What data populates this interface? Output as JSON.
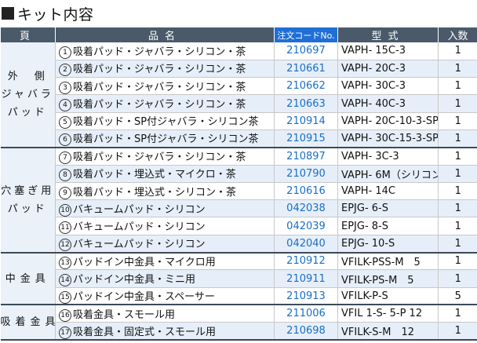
{
  "title": "キット内容",
  "header": {
    "page": "頁",
    "name": "品名",
    "code": "注文コードNo.",
    "model": "型式",
    "qty": "入数"
  },
  "groups": [
    {
      "label_lines": [
        "外　側",
        "ジャバラ",
        "パッド"
      ],
      "rows": [
        {
          "num": "1",
          "name": "吸着パッド・ジャバラ・シリコン・茶",
          "code": "210697",
          "model": "VAPH- 15C-3",
          "qty": "1"
        },
        {
          "num": "2",
          "name": "吸着パッド・ジャバラ・シリコン・茶",
          "code": "210661",
          "model": "VAPH- 20C-3",
          "qty": "1"
        },
        {
          "num": "3",
          "name": "吸着パッド・ジャバラ・シリコン・茶",
          "code": "210662",
          "model": "VAPH- 30C-3",
          "qty": "1"
        },
        {
          "num": "4",
          "name": "吸着パッド・ジャバラ・シリコン・茶",
          "code": "210663",
          "model": "VAPH- 40C-3",
          "qty": "1"
        },
        {
          "num": "5",
          "name": "吸着パッド・SP付ジャバラ・シリコン茶",
          "code": "210914",
          "model": "VAPH- 20C-10-3-SP",
          "qty": "1"
        },
        {
          "num": "6",
          "name": "吸着パッド・SP付ジャバラ・シリコン茶",
          "code": "210915",
          "model": "VAPH- 30C-15-3-SP",
          "qty": "1"
        }
      ]
    },
    {
      "label_lines": [
        "穴塞ぎ用",
        "パッド"
      ],
      "rows": [
        {
          "num": "7",
          "name": "吸着パッド・ジャバラ・シリコン・茶",
          "code": "210897",
          "model": "VAPH- 3C-3",
          "qty": "1"
        },
        {
          "num": "8",
          "name": "吸着パッド・埋込式・マイクロ・茶",
          "code": "210790",
          "model": "VAPH- 6M（シリコン）",
          "qty": "1"
        },
        {
          "num": "9",
          "name": "吸着パッド・埋込式・シリコン・茶",
          "code": "210616",
          "model": "VAPH- 14C",
          "qty": "1"
        },
        {
          "num": "10",
          "name": "バキュームパッド・シリコン",
          "code": "042038",
          "model": "EPJG- 6-S",
          "qty": "1"
        },
        {
          "num": "11",
          "name": "バキュームパッド・シリコン",
          "code": "042039",
          "model": "EPJG- 8-S",
          "qty": "1"
        },
        {
          "num": "12",
          "name": "バキュームパッド・シリコン",
          "code": "042040",
          "model": "EPJG- 10-S",
          "qty": "1"
        }
      ]
    },
    {
      "label_lines": [
        "中金具"
      ],
      "rows": [
        {
          "num": "13",
          "name": "パッドイン中金具・マイクロ用",
          "code": "210912",
          "model": "VFILK-PSS-M　5",
          "qty": "1"
        },
        {
          "num": "14",
          "name": "パッドイン中金具・ミニ用",
          "code": "210911",
          "model": "VFILK-PS-M　5",
          "qty": "1"
        },
        {
          "num": "15",
          "name": "パッドイン中金具・スペーサー",
          "code": "210913",
          "model": "VFILK-P-S",
          "qty": "5"
        }
      ]
    },
    {
      "label_lines": [
        "吸着金具"
      ],
      "rows": [
        {
          "num": "16",
          "name": "吸着金具・スモール用",
          "code": "211006",
          "model": "VFIL 1-S- 5-P 12",
          "qty": "1"
        },
        {
          "num": "17",
          "name": "吸着金具・固定式・スモール用",
          "code": "210698",
          "model": "VFILK-S-M　12",
          "qty": "1"
        }
      ]
    }
  ]
}
